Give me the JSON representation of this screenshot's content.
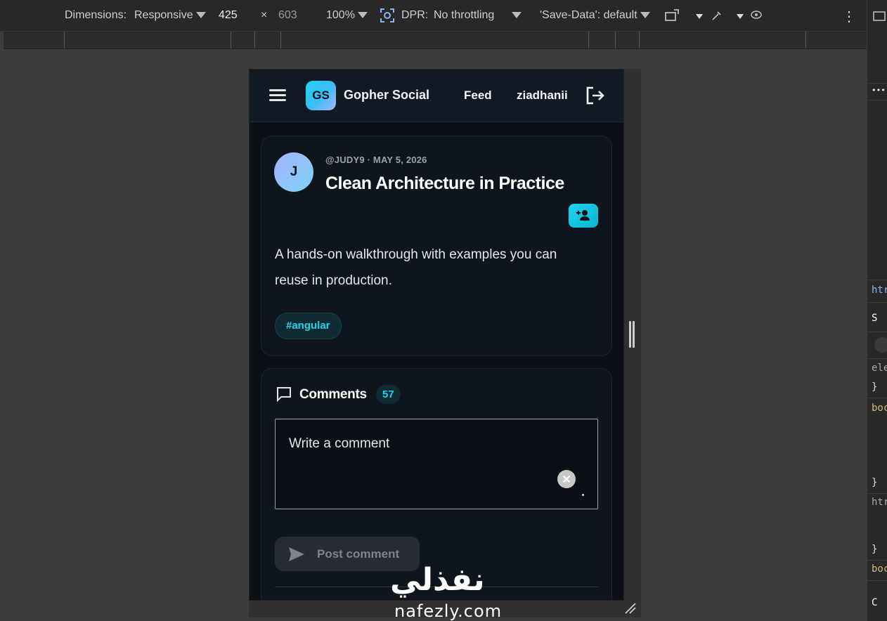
{
  "devtools": {
    "dimensions_label": "Dimensions:",
    "dimensions_mode": "Responsive",
    "width": "425",
    "times": "×",
    "height": "603",
    "zoom": "100%",
    "dpr_label": "DPR:",
    "throttling": "No throttling",
    "save_data": "'Save-Data': default",
    "more": "⋮"
  },
  "right_panel": {
    "lines": [
      "•••",
      "htr",
      "S",
      "ele",
      "}",
      "boc",
      "}",
      "htr",
      "}",
      "boc",
      "C"
    ]
  },
  "app": {
    "logo_text": "GS",
    "brand": "Gopher Social",
    "nav_feed": "Feed",
    "nav_user": "ziadhanii"
  },
  "post": {
    "avatar_letter": "J",
    "meta": "@JUDY9 · MAY 5, 2026",
    "title": "Clean Architecture in Practice",
    "body": "A hands-on walkthrough with examples you can reuse in production.",
    "tag": "#angular"
  },
  "comments": {
    "title": "Comments",
    "count": "57",
    "placeholder": "Write a comment",
    "clear": "✕",
    "post_button": "Post comment"
  },
  "watermark": {
    "arabic": "نفذلي",
    "latin": "nafezly.com"
  },
  "colors": {
    "accent": "#22d3ee",
    "app_bg": "#0d1117",
    "card_bg": "#0f151d"
  }
}
